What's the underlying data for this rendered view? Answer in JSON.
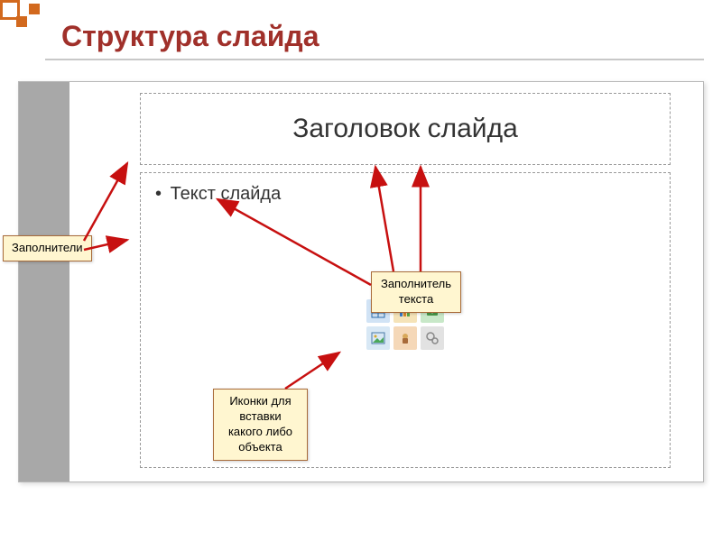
{
  "page": {
    "title": "Структура слайда"
  },
  "slide": {
    "title_placeholder": "Заголовок слайда",
    "content_text": "Текст слайда"
  },
  "callouts": {
    "placeholders": "Заполнители",
    "text_placeholder": "Заполнитель текста",
    "icons_label": "Иконки для вставки какого либо объекта"
  },
  "icons": {
    "table": "table-icon",
    "chart": "chart-icon",
    "smartart": "smartart-icon",
    "picture": "picture-icon",
    "clipart": "clipart-icon",
    "media": "media-icon"
  }
}
